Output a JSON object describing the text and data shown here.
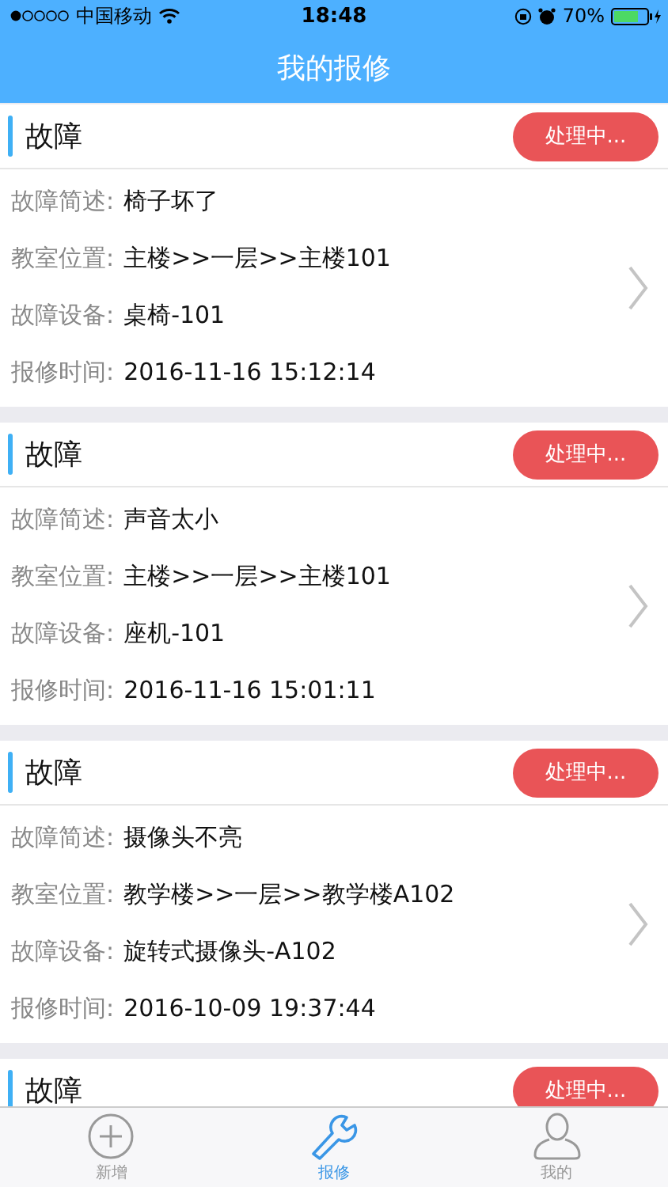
{
  "status_bar": {
    "carrier": "中国移动",
    "time": "18:48",
    "battery": "70%"
  },
  "nav": {
    "title": "我的报修"
  },
  "cards": [
    {
      "title": "故障",
      "status": "处理中...",
      "fields": [
        {
          "label": "故障简述:",
          "value": "椅子坏了"
        },
        {
          "label": "教室位置:",
          "value": "主楼>>一层>>主楼101"
        },
        {
          "label": "故障设备:",
          "value": "桌椅-101"
        },
        {
          "label": "报修时间:",
          "value": "2016-11-16 15:12:14"
        }
      ]
    },
    {
      "title": "故障",
      "status": "处理中...",
      "fields": [
        {
          "label": "故障简述:",
          "value": "声音太小"
        },
        {
          "label": "教室位置:",
          "value": "主楼>>一层>>主楼101"
        },
        {
          "label": "故障设备:",
          "value": "座机-101"
        },
        {
          "label": "报修时间:",
          "value": "2016-11-16 15:01:11"
        }
      ]
    },
    {
      "title": "故障",
      "status": "处理中...",
      "fields": [
        {
          "label": "故障简述:",
          "value": "摄像头不亮"
        },
        {
          "label": "教室位置:",
          "value": "教学楼>>一层>>教学楼A102"
        },
        {
          "label": "故障设备:",
          "value": "旋转式摄像头-A102"
        },
        {
          "label": "报修时间:",
          "value": "2016-10-09 19:37:44"
        }
      ]
    },
    {
      "title": "故障",
      "status": "处理中..."
    }
  ],
  "tabs": [
    {
      "kind": "add",
      "label": "新增",
      "selected": false
    },
    {
      "kind": "repair",
      "label": "报修",
      "selected": true
    },
    {
      "kind": "me",
      "label": "我的",
      "selected": false
    }
  ]
}
